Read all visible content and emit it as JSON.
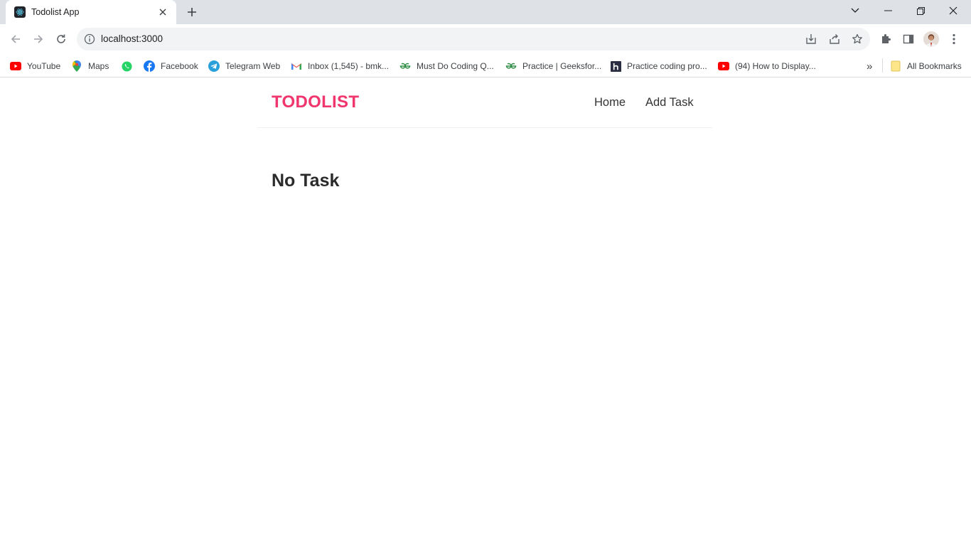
{
  "browser": {
    "tab_title": "Todolist App",
    "url": "localhost:3000",
    "bookmarks": [
      {
        "label": "YouTube",
        "icon": "youtube-icon"
      },
      {
        "label": "Maps",
        "icon": "maps-icon"
      },
      {
        "label": "",
        "icon": "whatsapp-icon"
      },
      {
        "label": "Facebook",
        "icon": "facebook-icon"
      },
      {
        "label": "Telegram Web",
        "icon": "telegram-icon"
      },
      {
        "label": "Inbox (1,545) - bmk...",
        "icon": "gmail-icon"
      },
      {
        "label": "Must Do Coding Q...",
        "icon": "geeksforgeeks-icon"
      },
      {
        "label": "Practice | Geeksfor...",
        "icon": "geeksforgeeks-icon"
      },
      {
        "label": "Practice coding pro...",
        "icon": "hackerrank-icon"
      },
      {
        "label": "(94) How to Display...",
        "icon": "youtube-icon"
      }
    ],
    "all_bookmarks_label": "All Bookmarks",
    "overflow_label": "»"
  },
  "app": {
    "brand": "TODOLIST",
    "nav": {
      "home": "Home",
      "add_task": "Add Task"
    },
    "empty_message": "No Task"
  },
  "colors": {
    "brand": "#f1356d",
    "tabstrip": "#dee1e6",
    "omnibox": "#f1f3f4"
  }
}
